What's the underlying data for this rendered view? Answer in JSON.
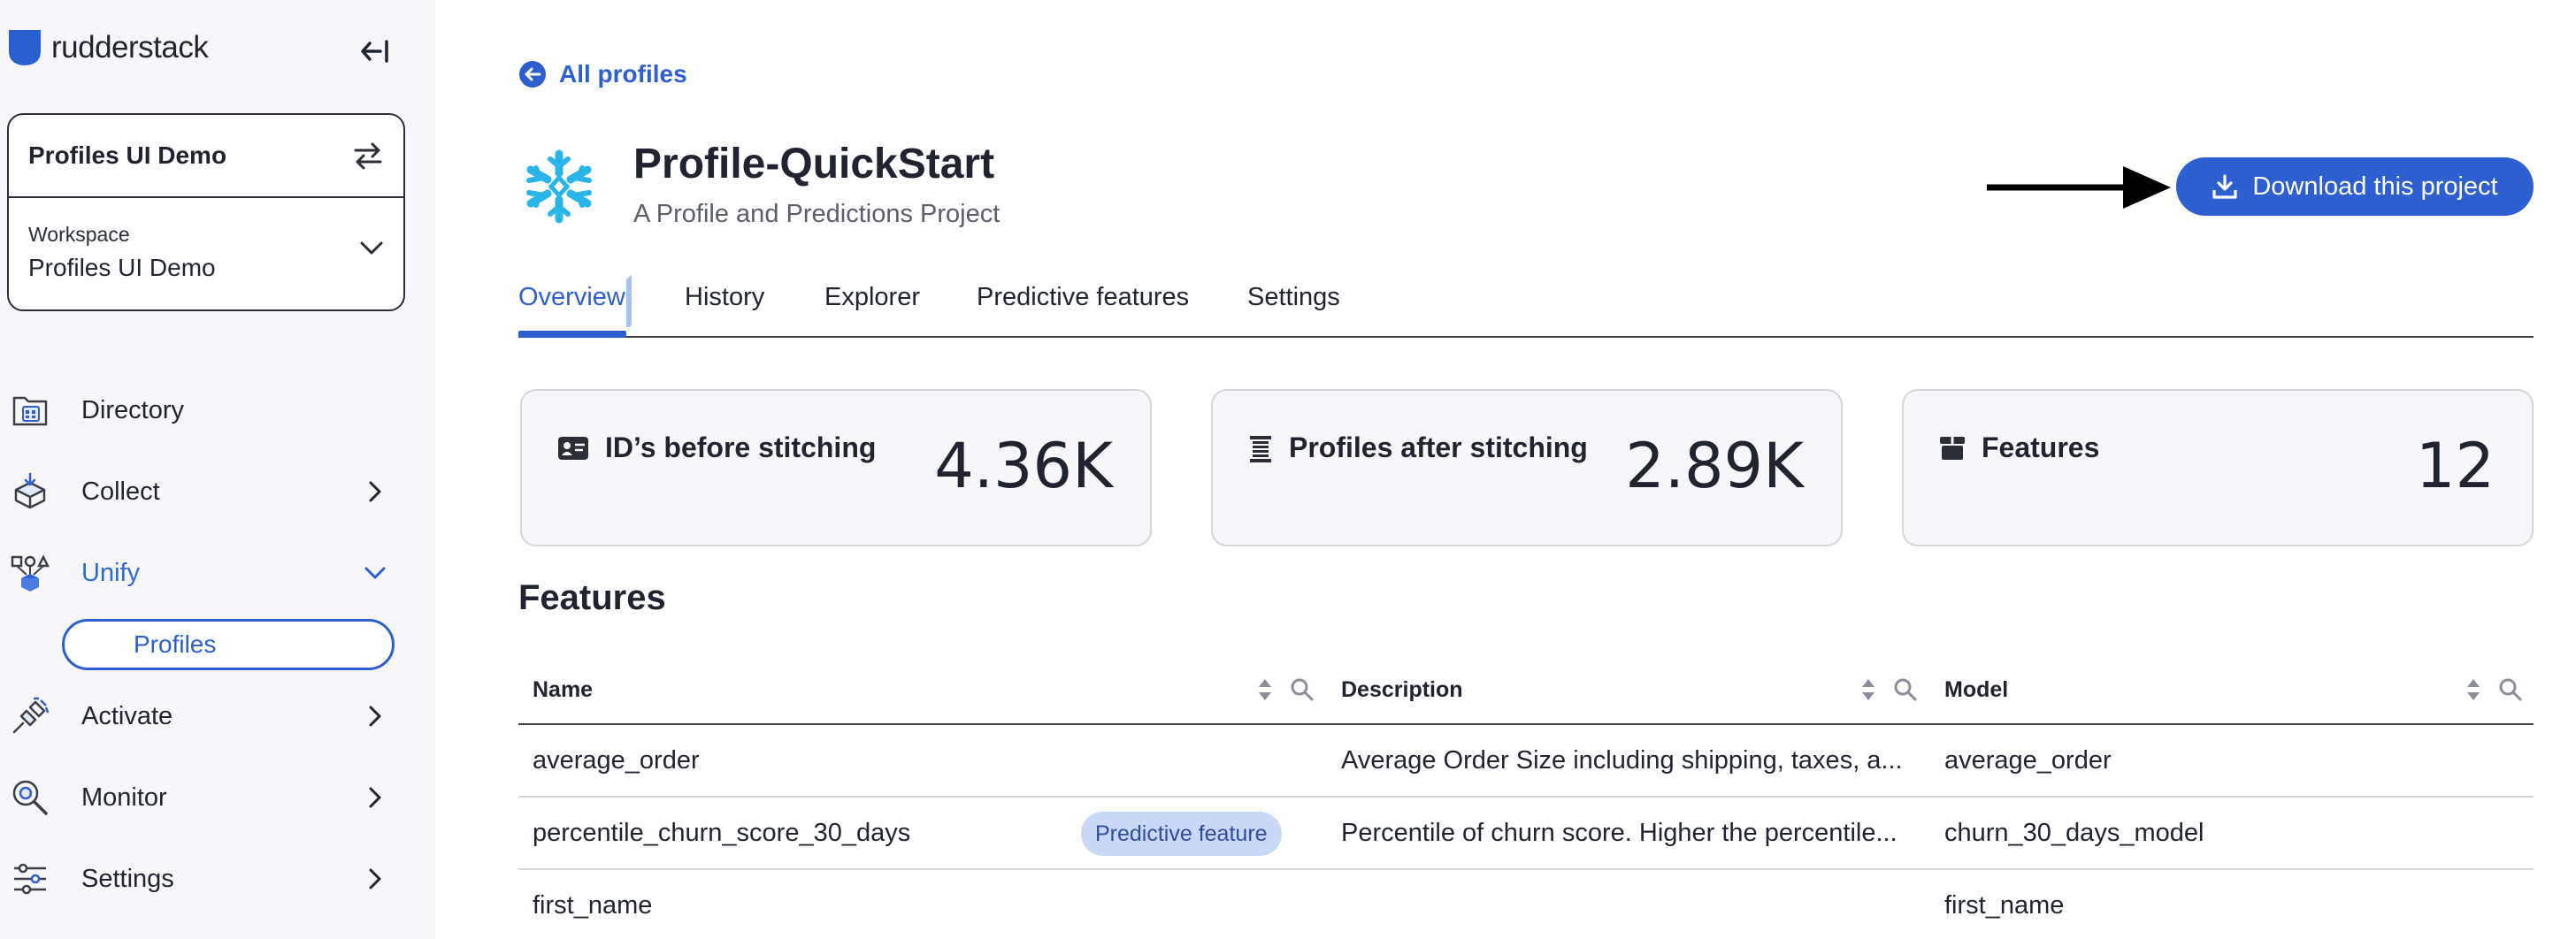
{
  "brand": {
    "name": "rudderstack"
  },
  "workspace": {
    "current": "Profiles UI Demo",
    "label": "Workspace",
    "value": "Profiles UI Demo"
  },
  "nav": {
    "directory": "Directory",
    "collect": "Collect",
    "unify": "Unify",
    "profiles": "Profiles",
    "activate": "Activate",
    "monitor": "Monitor",
    "settings": "Settings"
  },
  "back": {
    "label": "All profiles"
  },
  "project": {
    "title": "Profile-QuickStart",
    "subtitle": "A Profile and Predictions Project"
  },
  "download": {
    "label": "Download this project"
  },
  "tabs": [
    "Overview",
    "History",
    "Explorer",
    "Predictive features",
    "Settings"
  ],
  "stats": [
    {
      "label": "ID’s before stitching",
      "value": "4.36K"
    },
    {
      "label": "Profiles after stitching",
      "value": "2.89K"
    },
    {
      "label": "Features",
      "value": "12"
    }
  ],
  "features": {
    "title": "Features",
    "columns": [
      "Name",
      "Description",
      "Model"
    ],
    "rows": [
      {
        "name": "average_order",
        "badge": "",
        "description": "Average Order Size including shipping, taxes, a...",
        "model": "average_order"
      },
      {
        "name": "percentile_churn_score_30_days",
        "badge": "Predictive feature",
        "description": "Percentile of churn score. Higher the percentile...",
        "model": "churn_30_days_model"
      },
      {
        "name": "first_name",
        "badge": "",
        "description": "",
        "model": "first_name"
      }
    ]
  },
  "colors": {
    "accent": "#2d5fd0",
    "sidebar_bg": "#f7f7f9",
    "badge_bg": "#c9d8f6"
  }
}
